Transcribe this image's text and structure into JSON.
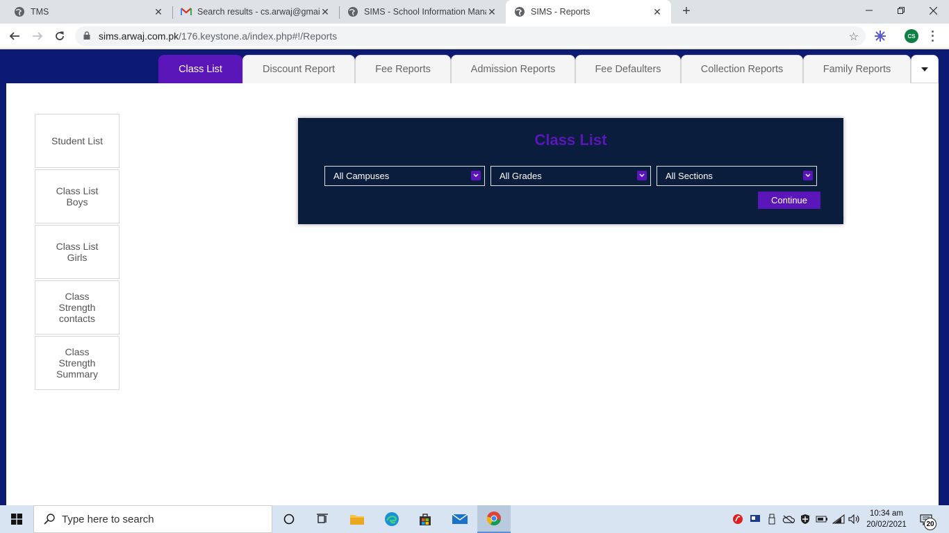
{
  "browser": {
    "tabs": [
      {
        "title": "TMS",
        "icon": "globe-icon",
        "active": false
      },
      {
        "title": "Search results - cs.arwaj@gmail.c",
        "icon": "gmail-icon",
        "active": false
      },
      {
        "title": "SIMS - School Information Mana",
        "icon": "globe-icon",
        "active": false
      },
      {
        "title": "SIMS - Reports",
        "icon": "globe-icon",
        "active": true
      }
    ],
    "url_host": "sims.arwaj.com.pk",
    "url_path": "/176.keystone.a/index.php#!/Reports",
    "profile_initials": "CS"
  },
  "report_tabs": [
    {
      "label": "Class List",
      "active": true
    },
    {
      "label": "Discount Report",
      "active": false
    },
    {
      "label": "Fee Reports",
      "active": false
    },
    {
      "label": "Admission Reports",
      "active": false
    },
    {
      "label": "Fee Defaulters",
      "active": false
    },
    {
      "label": "Collection Reports",
      "active": false
    },
    {
      "label": "Family Reports",
      "active": false
    }
  ],
  "sidenav": [
    {
      "label": "Student List"
    },
    {
      "label": "Class List\nBoys"
    },
    {
      "label": "Class List\nGirls"
    },
    {
      "label": "Class\nStrength\ncontacts"
    },
    {
      "label": "Class\nStrength\nSummary"
    }
  ],
  "panel": {
    "title": "Class List",
    "campus_value": "All Campuses",
    "grade_value": "All Grades",
    "section_value": "All Sections",
    "continue_label": "Continue"
  },
  "taskbar": {
    "search_placeholder": "Type here to search",
    "time": "10:34 am",
    "date": "20/02/2021",
    "notification_count": "20"
  },
  "colors": {
    "accent_purple": "#5a16b8",
    "page_navy": "#0d1a73",
    "panel_navy": "#0b1d3d"
  }
}
